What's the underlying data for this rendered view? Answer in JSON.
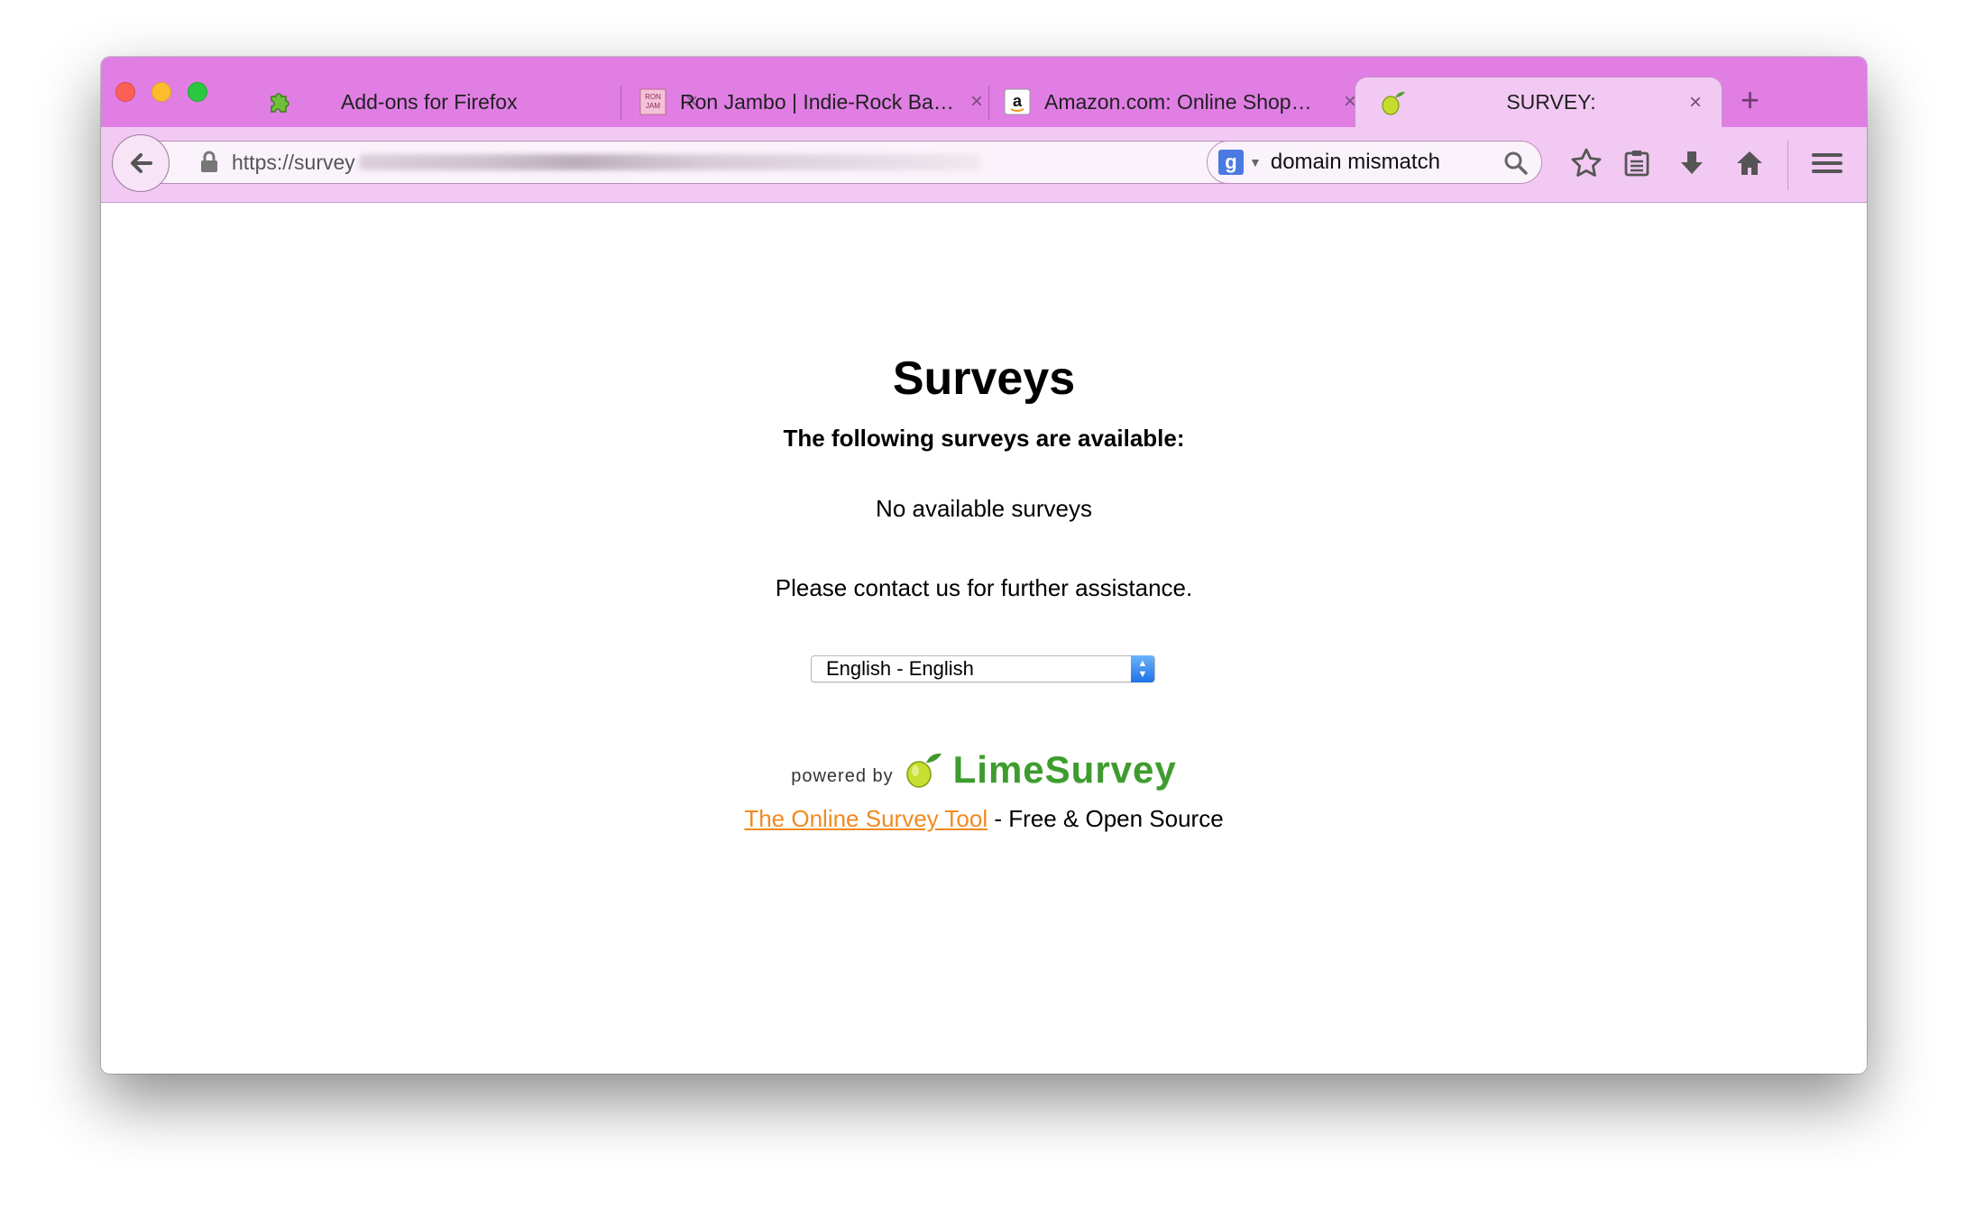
{
  "tabs": [
    {
      "label": "Add-ons for Firefox",
      "icon": "puzzle-piece-icon"
    },
    {
      "label": "Ron Jambo | Indie-Rock Ba…",
      "icon": "ron-jambo-favicon"
    },
    {
      "label": "Amazon.com: Online Shop…",
      "icon": "amazon-favicon"
    },
    {
      "label": "SURVEY:",
      "icon": "lime-favicon",
      "active": true
    }
  ],
  "close_glyph": "×",
  "new_tab_glyph": "+",
  "address": {
    "visible_url": "https://survey"
  },
  "search": {
    "value": "domain mismatch"
  },
  "page": {
    "title": "Surveys",
    "subtitle": "The following surveys are available:",
    "no_surveys": "No available surveys",
    "contact": "Please contact us for further assistance.",
    "language": "English - English",
    "powered_by": "powered by",
    "brand": "LimeSurvey",
    "link_text": "The Online Survey Tool",
    "footer_suffix": " - Free & Open Source"
  },
  "colors": {
    "toolbar": "#e07ee4",
    "navbar": "#f2c9f3",
    "link": "#f18a21",
    "brand": "#3e9c2e"
  }
}
